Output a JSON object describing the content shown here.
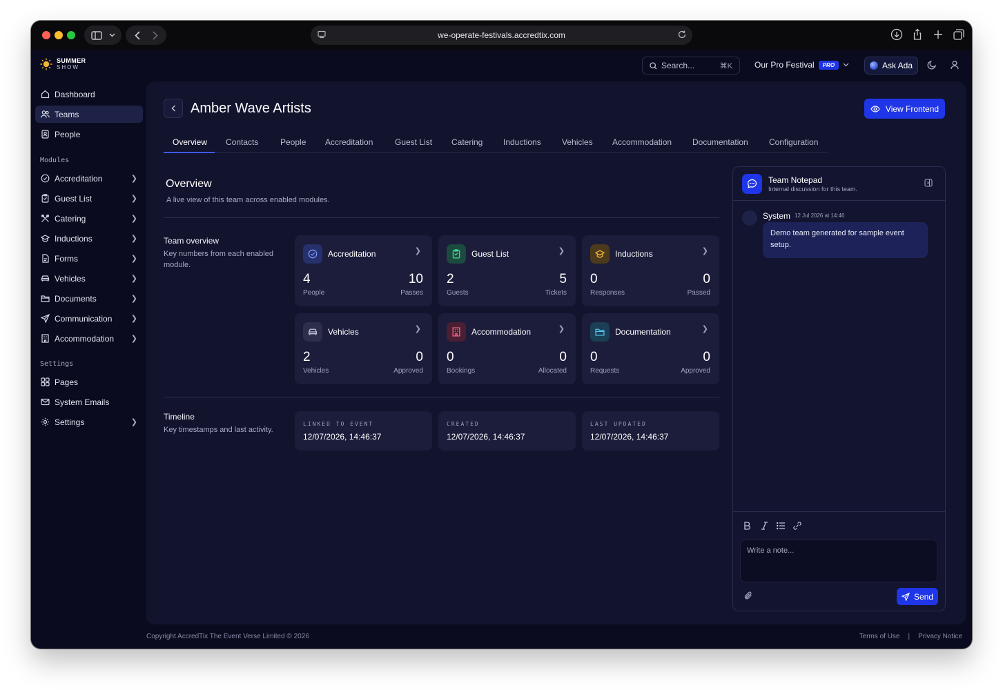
{
  "browser": {
    "url": "we-operate-festivals.accredtix.com"
  },
  "header": {
    "logo_line1": "SUMMER",
    "logo_line2": "SHOW",
    "search_placeholder": "Search...",
    "search_shortcut": "⌘K",
    "festival_name": "Our Pro Festival",
    "festival_badge": "PRO",
    "ask_ada_label": "Ask Ada"
  },
  "sidebar": {
    "main": [
      {
        "label": "Dashboard",
        "icon": "home-icon"
      },
      {
        "label": "Teams",
        "icon": "users-icon",
        "active": true
      },
      {
        "label": "People",
        "icon": "contact-icon"
      }
    ],
    "modules_heading": "Modules",
    "modules": [
      {
        "label": "Accreditation",
        "icon": "badge-check-icon"
      },
      {
        "label": "Guest List",
        "icon": "clipboard-icon"
      },
      {
        "label": "Catering",
        "icon": "utensils-icon"
      },
      {
        "label": "Inductions",
        "icon": "graduation-cap-icon"
      },
      {
        "label": "Forms",
        "icon": "form-icon"
      },
      {
        "label": "Vehicles",
        "icon": "car-icon"
      },
      {
        "label": "Documents",
        "icon": "folder-icon"
      },
      {
        "label": "Communication",
        "icon": "send-icon"
      },
      {
        "label": "Accommodation",
        "icon": "building-icon"
      }
    ],
    "settings_heading": "Settings",
    "settings": [
      {
        "label": "Pages",
        "icon": "grid-icon"
      },
      {
        "label": "System Emails",
        "icon": "mail-icon"
      },
      {
        "label": "Settings",
        "icon": "gear-icon"
      }
    ]
  },
  "page": {
    "title": "Amber Wave Artists",
    "view_frontend_label": "View Frontend",
    "tabs": [
      "Overview",
      "Contacts",
      "People",
      "Accreditation",
      "Guest List",
      "Catering",
      "Inductions",
      "Vehicles",
      "Accommodation",
      "Documentation",
      "Configuration"
    ],
    "active_tab": "Overview",
    "overview_title": "Overview",
    "overview_subtitle": "A live view of this team across enabled modules.",
    "team_overview": {
      "title": "Team overview",
      "subtitle": "Key numbers from each enabled module.",
      "cards": [
        {
          "name": "Accreditation",
          "v1": "4",
          "l1": "People",
          "v2": "10",
          "l2": "Passes",
          "color": "#5b7cff"
        },
        {
          "name": "Guest List",
          "v1": "2",
          "l1": "Guests",
          "v2": "5",
          "l2": "Tickets",
          "color": "#3fbf86"
        },
        {
          "name": "Inductions",
          "v1": "0",
          "l1": "Responses",
          "v2": "0",
          "l2": "Passed",
          "color": "#e3a63a"
        },
        {
          "name": "Vehicles",
          "v1": "2",
          "l1": "Vehicles",
          "v2": "0",
          "l2": "Approved",
          "color": "#c3c6d8"
        },
        {
          "name": "Accommodation",
          "v1": "0",
          "l1": "Bookings",
          "v2": "0",
          "l2": "Allocated",
          "color": "#e35a74"
        },
        {
          "name": "Documentation",
          "v1": "0",
          "l1": "Requests",
          "v2": "0",
          "l2": "Approved",
          "color": "#4cb8e8"
        }
      ]
    },
    "timeline": {
      "title": "Timeline",
      "subtitle": "Key timestamps and last activity.",
      "items": [
        {
          "label": "LINKED TO EVENT",
          "value": "12/07/2026, 14:46:37"
        },
        {
          "label": "CREATED",
          "value": "12/07/2026, 14:46:37"
        },
        {
          "label": "LAST UPDATED",
          "value": "12/07/2026, 14:46:37"
        }
      ]
    }
  },
  "notepad": {
    "title": "Team Notepad",
    "subtitle": "Internal discussion for this team.",
    "message": {
      "author": "System",
      "time": "12 Jul 2026 at 14:46",
      "text": "Demo team generated for sample event setup."
    },
    "input_placeholder": "Write a note...",
    "send_label": "Send"
  },
  "footer": {
    "copyright": "Copyright AccredTix The Event Verse Limited © 2026",
    "terms": "Terms of Use",
    "separator": "|",
    "privacy": "Privacy Notice"
  }
}
